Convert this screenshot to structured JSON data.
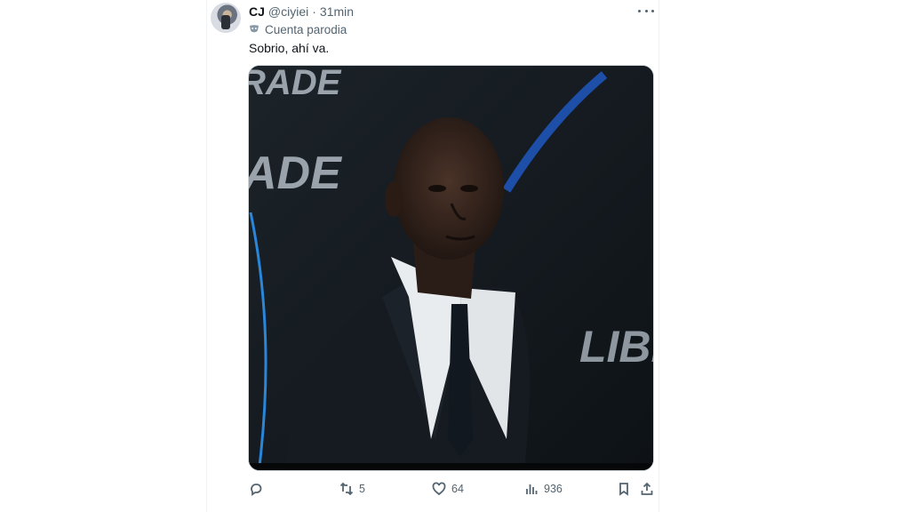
{
  "tweet": {
    "author_name": "CJ",
    "handle": "@ciyiei",
    "separator": "·",
    "time": "31min",
    "label": "Cuenta parodia",
    "text": "Sobrio, ahí va.",
    "media": {
      "banner_text_top": "RADE",
      "banner_text_mid": "ADE",
      "banner_text_right": "LIBE"
    }
  },
  "actions": {
    "replies": "",
    "retweets": "5",
    "likes": "64",
    "views": "936"
  },
  "colors": {
    "text_primary": "#0f1419",
    "text_secondary": "#536471",
    "accent_blue": "#1d4ea8"
  },
  "icons": [
    "more-icon",
    "parody-mask-icon",
    "reply-icon",
    "retweet-icon",
    "like-icon",
    "views-icon",
    "bookmark-icon",
    "share-icon"
  ]
}
